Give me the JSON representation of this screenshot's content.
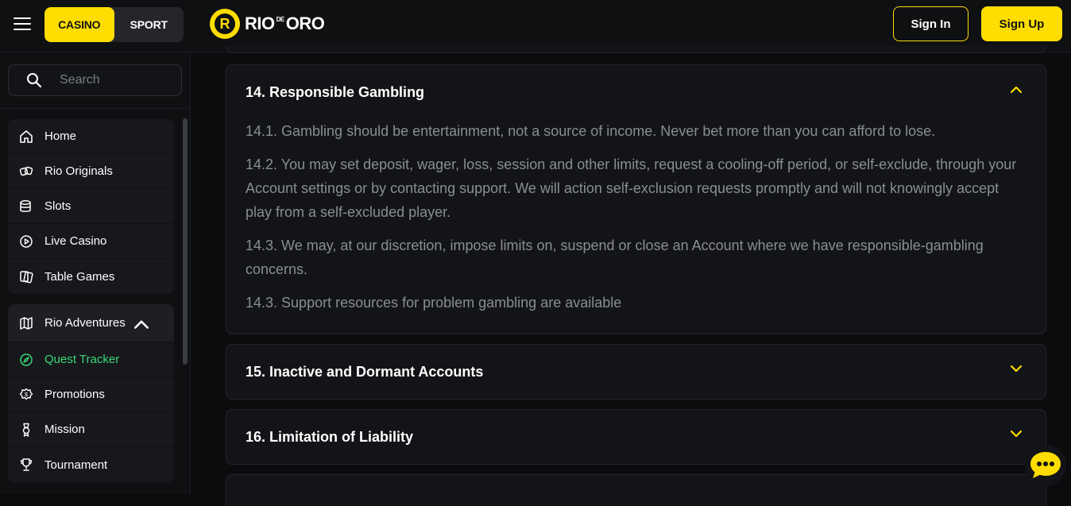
{
  "header": {
    "tabs": [
      {
        "label": "CASINO",
        "active": true
      },
      {
        "label": "SPORT",
        "active": false
      }
    ],
    "logo": {
      "left": "RIO",
      "de": "DE",
      "right": "ORO"
    },
    "sign_in": "Sign In",
    "sign_up": "Sign Up"
  },
  "search": {
    "placeholder": "Search"
  },
  "sidebar": {
    "main_items": [
      {
        "label": "Home",
        "icon": "home-icon"
      },
      {
        "label": "Rio Originals",
        "icon": "originals-icon"
      },
      {
        "label": "Slots",
        "icon": "slots-icon"
      },
      {
        "label": "Live Casino",
        "icon": "play-circle-icon"
      },
      {
        "label": "Table Games",
        "icon": "cards-icon"
      }
    ],
    "adventures": {
      "label": "Rio Adventures",
      "items": [
        {
          "label": "Quest Tracker",
          "icon": "compass-icon",
          "active": true
        },
        {
          "label": "Promotions",
          "icon": "promotions-icon"
        },
        {
          "label": "Mission",
          "icon": "medal-icon"
        },
        {
          "label": "Tournament",
          "icon": "trophy-icon"
        }
      ]
    }
  },
  "sections": [
    {
      "title": "14. Responsible Gambling",
      "expanded": true,
      "paragraphs": [
        "14.1. Gambling should be entertainment, not a source of income. Never bet more than you can afford to lose.",
        "14.2. You may set deposit, wager, loss, session and other limits, request a cooling-off period, or self-exclude, through your Account settings or by contacting support. We will action self-exclusion requests promptly and will not knowingly accept play from a self-excluded player.",
        "14.3. We may, at our discretion, impose limits on, suspend or close an Account where we have responsible-gambling concerns.",
        "14.3. Support resources for problem gambling are available"
      ]
    },
    {
      "title": "15. Inactive and Dormant Accounts",
      "expanded": false
    },
    {
      "title": "16. Limitation of Liability",
      "expanded": false
    }
  ],
  "colors": {
    "accent": "#ffdd00",
    "active_nav": "#38d877"
  }
}
